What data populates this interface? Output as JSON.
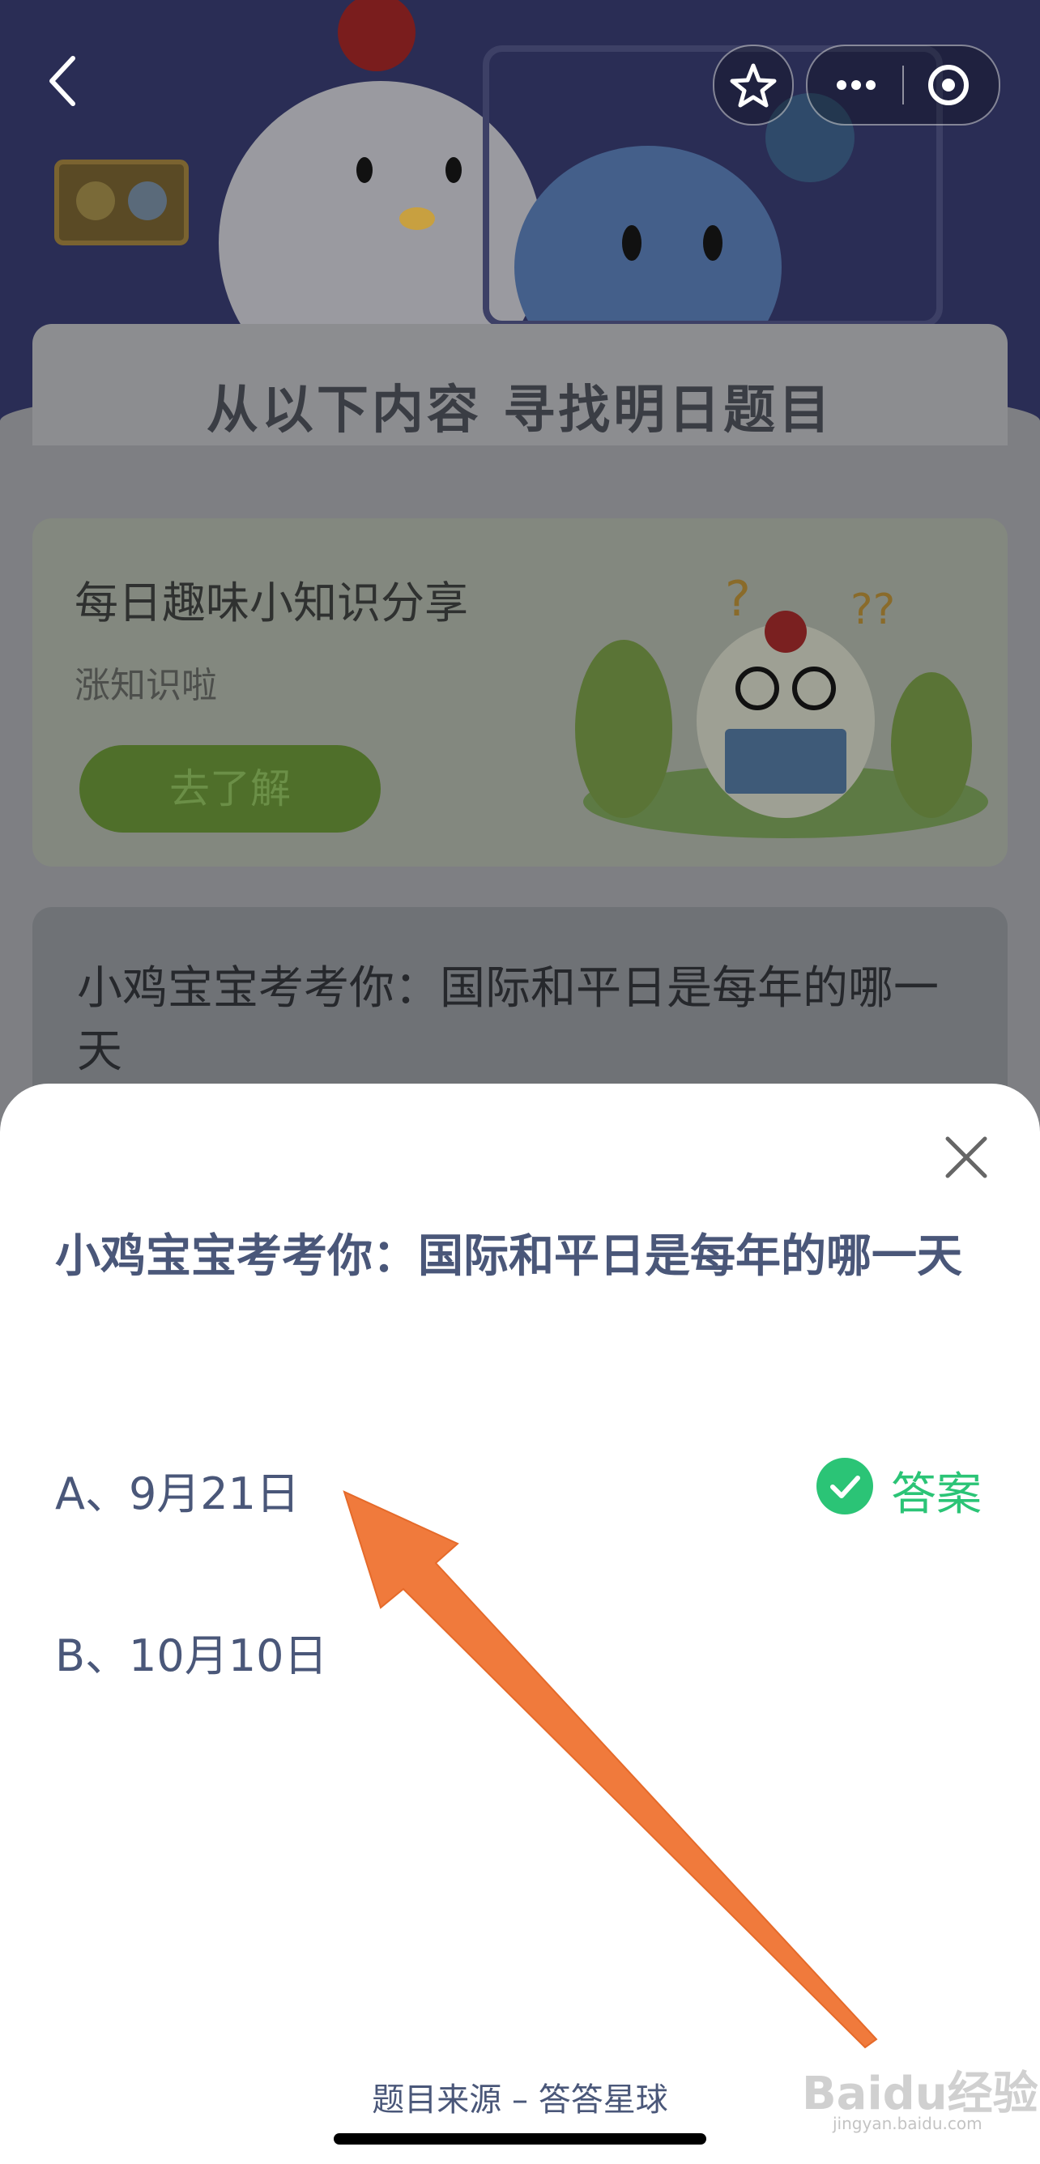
{
  "nav": {
    "back_icon": "chevron-left-icon",
    "favorite_icon": "star-icon",
    "more_icon": "more-dots-icon",
    "close_icon": "target-circle-icon"
  },
  "header": {
    "title": "从以下内容 寻找明日题目"
  },
  "knowledge_card": {
    "title": "每日趣味小知识分享",
    "subtitle": "涨知识啦",
    "button": "去了解"
  },
  "question_card": {
    "title": "小鸡宝宝考考你：国际和平日是每年的哪一天"
  },
  "sheet": {
    "question": "小鸡宝宝考考你：国际和平日是每年的哪一天",
    "options": [
      {
        "label": "A、9月21日",
        "is_answer": true
      },
      {
        "label": "B、10月10日",
        "is_answer": false
      }
    ],
    "answer_label": "答案",
    "source": "题目来源 – 答答星球"
  },
  "watermark": {
    "main": "Baidu经验",
    "sub": "jingyan.baidu.com"
  },
  "colors": {
    "accent_green": "#2bc476",
    "question_text": "#4a5779",
    "arrow": "#f07a3c"
  }
}
